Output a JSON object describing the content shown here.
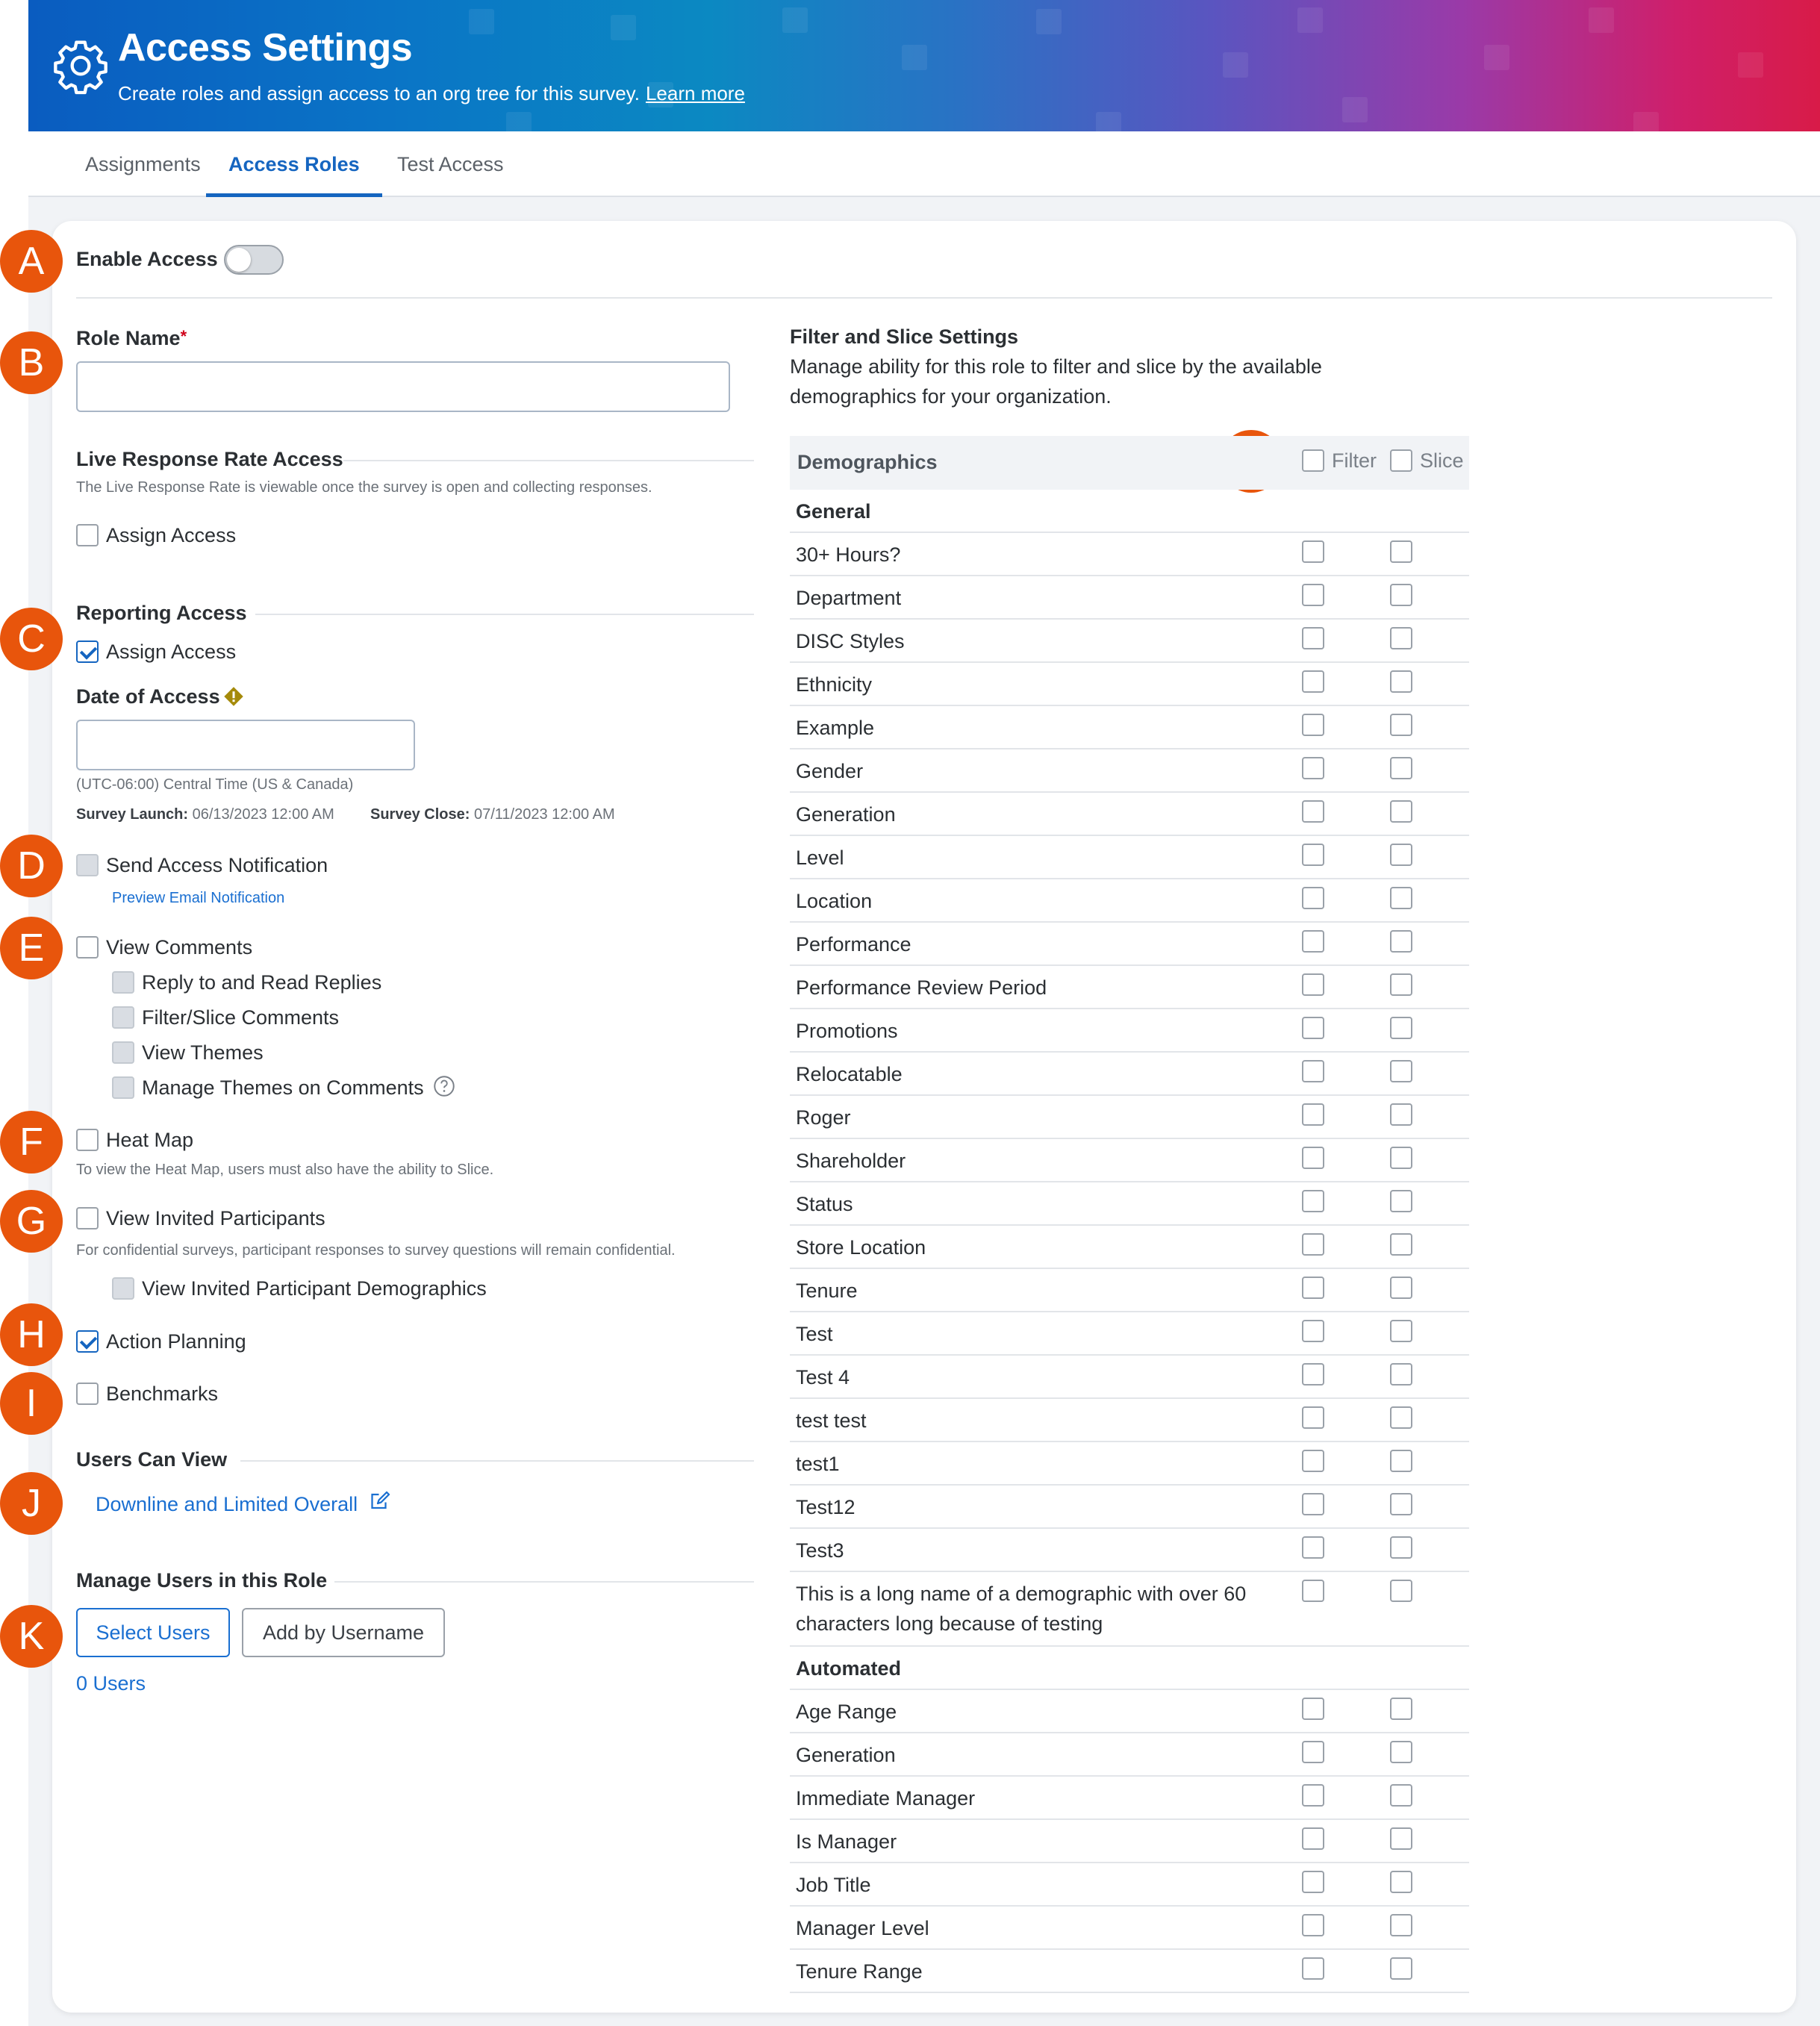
{
  "header": {
    "title": "Access Settings",
    "subtitle": "Create roles and assign access to an org tree for this survey.",
    "learn_more": "Learn more"
  },
  "tabs": [
    {
      "label": "Assignments",
      "active": false
    },
    {
      "label": "Access Roles",
      "active": true
    },
    {
      "label": "Test Access",
      "active": false
    }
  ],
  "markers": [
    "A",
    "B",
    "C",
    "D",
    "E",
    "F",
    "G",
    "H",
    "I",
    "J",
    "K",
    "L"
  ],
  "enable_access": {
    "label": "Enable Access",
    "enabled": false
  },
  "role_name": {
    "label": "Role Name",
    "required_mark": "*",
    "value": ""
  },
  "live_response": {
    "title": "Live Response Rate Access",
    "description": "The Live Response Rate is viewable once the survey is open and collecting responses.",
    "assign_label": "Assign Access",
    "checked": false
  },
  "reporting": {
    "title": "Reporting Access",
    "assign_label": "Assign Access",
    "checked": true,
    "date_label": "Date of Access",
    "date_value": "",
    "timezone": "(UTC-06:00) Central Time (US & Canada)",
    "launch_label": "Survey Launch:",
    "launch_value": "06/13/2023 12:00 AM",
    "close_label": "Survey Close:",
    "close_value": "07/11/2023 12:00 AM"
  },
  "notification": {
    "label": "Send Access Notification",
    "preview_link": "Preview Email Notification"
  },
  "comments": {
    "label": "View Comments",
    "children": [
      "Reply to and Read Replies",
      "Filter/Slice Comments",
      "View Themes",
      "Manage Themes on Comments"
    ]
  },
  "heat_map": {
    "label": "Heat Map",
    "note": "To view the Heat Map, users must also have the ability to Slice."
  },
  "invited": {
    "label": "View Invited Participants",
    "note": "For confidential surveys, participant responses to survey questions will remain confidential.",
    "child": "View Invited Participant Demographics"
  },
  "action_planning": {
    "label": "Action Planning",
    "checked": true
  },
  "benchmarks": {
    "label": "Benchmarks",
    "checked": false
  },
  "users_can_view": {
    "title": "Users Can View",
    "link": "Downline and Limited Overall"
  },
  "manage_users": {
    "title": "Manage Users in this Role",
    "select_button": "Select Users",
    "add_button": "Add by Username",
    "count": "0 Users"
  },
  "filter_slice": {
    "title": "Filter and Slice Settings",
    "description_line1": "Manage ability for this role to filter and slice by the available",
    "description_line2": "demographics for your organization.",
    "column_demographics": "Demographics",
    "column_filter": "Filter",
    "column_slice": "Slice"
  },
  "demographic_groups": [
    {
      "name": "General",
      "items": [
        "30+ Hours?",
        "Department",
        "DISC Styles",
        "Ethnicity",
        "Example",
        "Gender",
        "Generation",
        "Level",
        "Location",
        "Performance",
        "Performance Review Period",
        "Promotions",
        "Relocatable",
        "Roger",
        "Shareholder",
        "Status",
        "Store Location",
        "Tenure",
        "Test",
        "Test 4",
        "test test",
        "test1",
        "Test12",
        "Test3"
      ],
      "long_item_line1": "This is a long name of a demographic with over 60",
      "long_item_line2": "characters long because of testing"
    },
    {
      "name": "Automated",
      "items": [
        "Age Range",
        "Generation",
        "Immediate Manager",
        "Is Manager",
        "Job Title",
        "Manager Level",
        "Tenure Range"
      ]
    }
  ],
  "colors": {
    "accent": "#1565c0",
    "marker": "#e8550c",
    "link": "#1a6fd1"
  }
}
